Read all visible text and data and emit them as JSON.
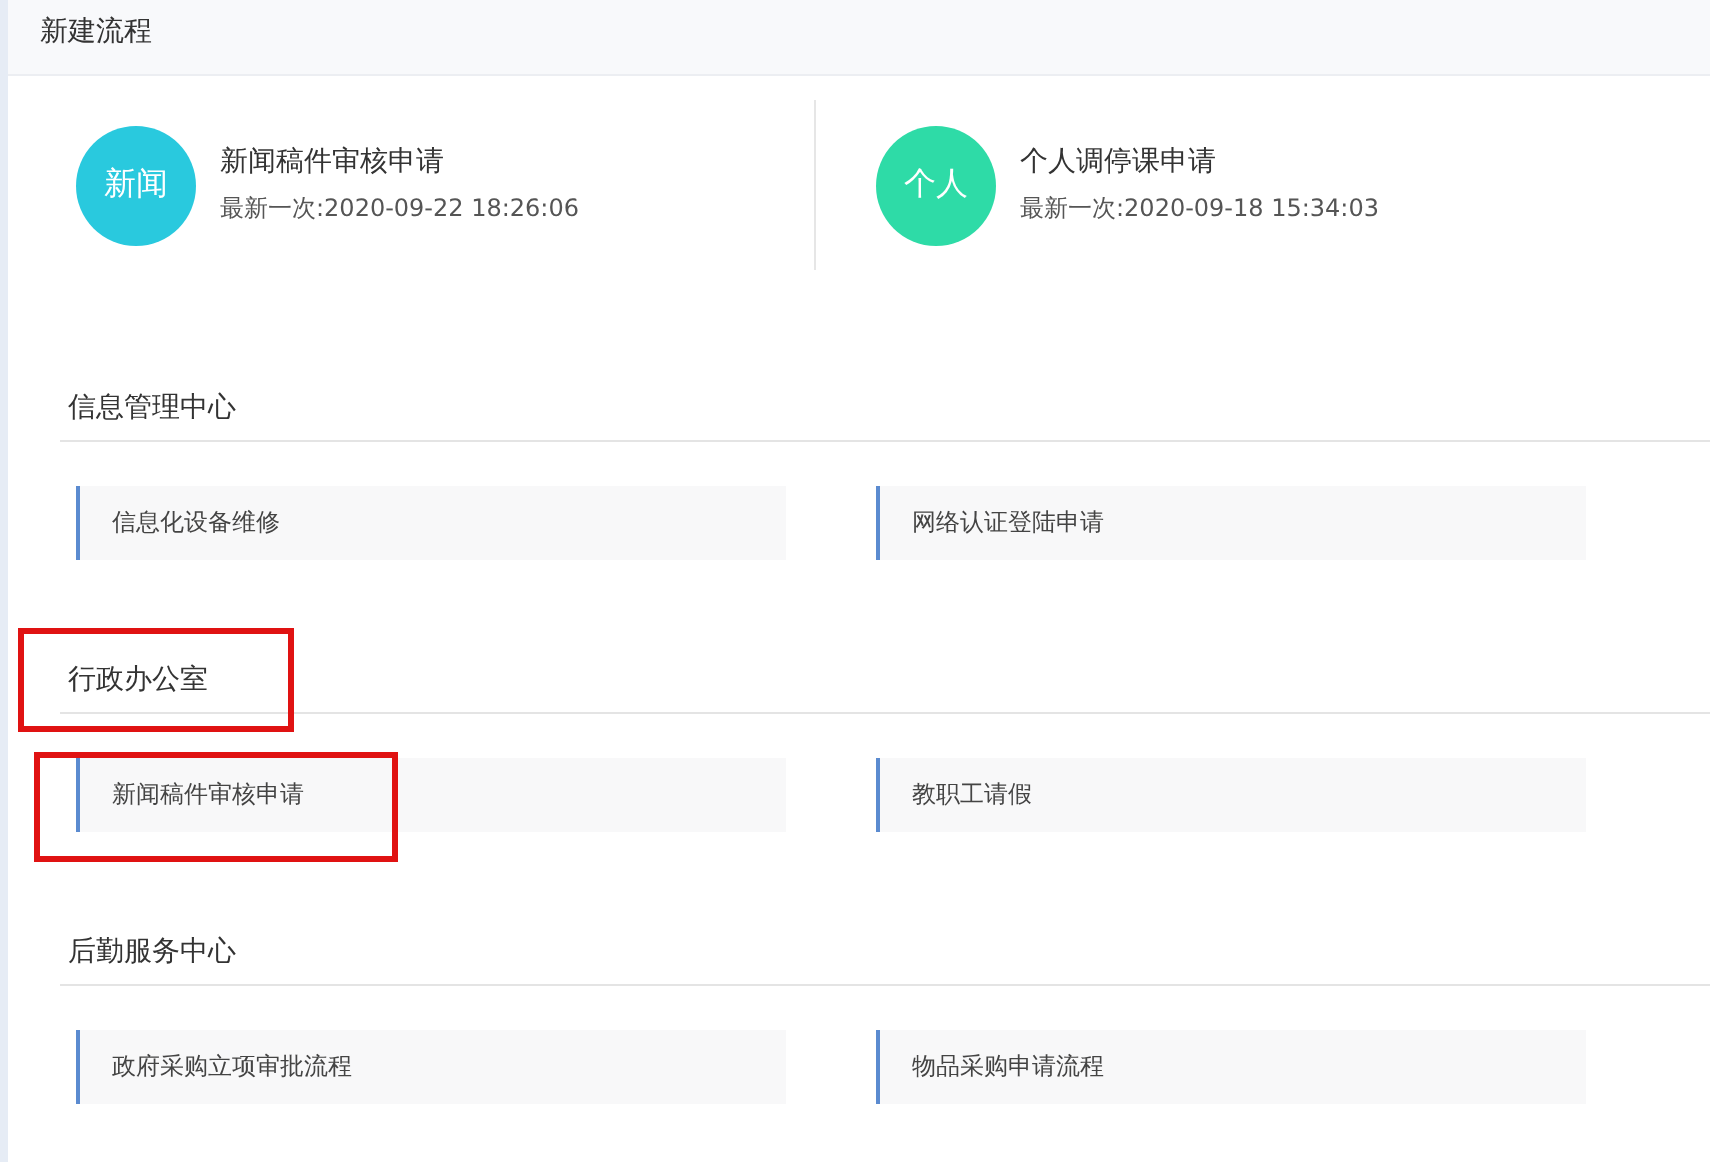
{
  "header": {
    "title": "新建流程"
  },
  "recent": [
    {
      "avatar": "新闻",
      "color": "#29c9de",
      "name": "新闻稿件审核申请",
      "time": "最新一次:2020-09-22 18:26:06"
    },
    {
      "avatar": "个人",
      "color": "#2edba7",
      "name": "个人调停课申请",
      "time": "最新一次:2020-09-18 15:34:03"
    }
  ],
  "sections": [
    {
      "title": "信息管理中心",
      "highlighted": false,
      "items": [
        {
          "label": "信息化设备维修",
          "highlighted": false
        },
        {
          "label": "网络认证登陆申请",
          "highlighted": false
        }
      ]
    },
    {
      "title": "行政办公室",
      "highlighted": true,
      "items": [
        {
          "label": "新闻稿件审核申请",
          "highlighted": true
        },
        {
          "label": "教职工请假",
          "highlighted": false
        }
      ]
    },
    {
      "title": "后勤服务中心",
      "highlighted": false,
      "items": [
        {
          "label": "政府采购立项审批流程",
          "highlighted": false
        },
        {
          "label": "物品采购申请流程",
          "highlighted": false
        }
      ]
    }
  ]
}
